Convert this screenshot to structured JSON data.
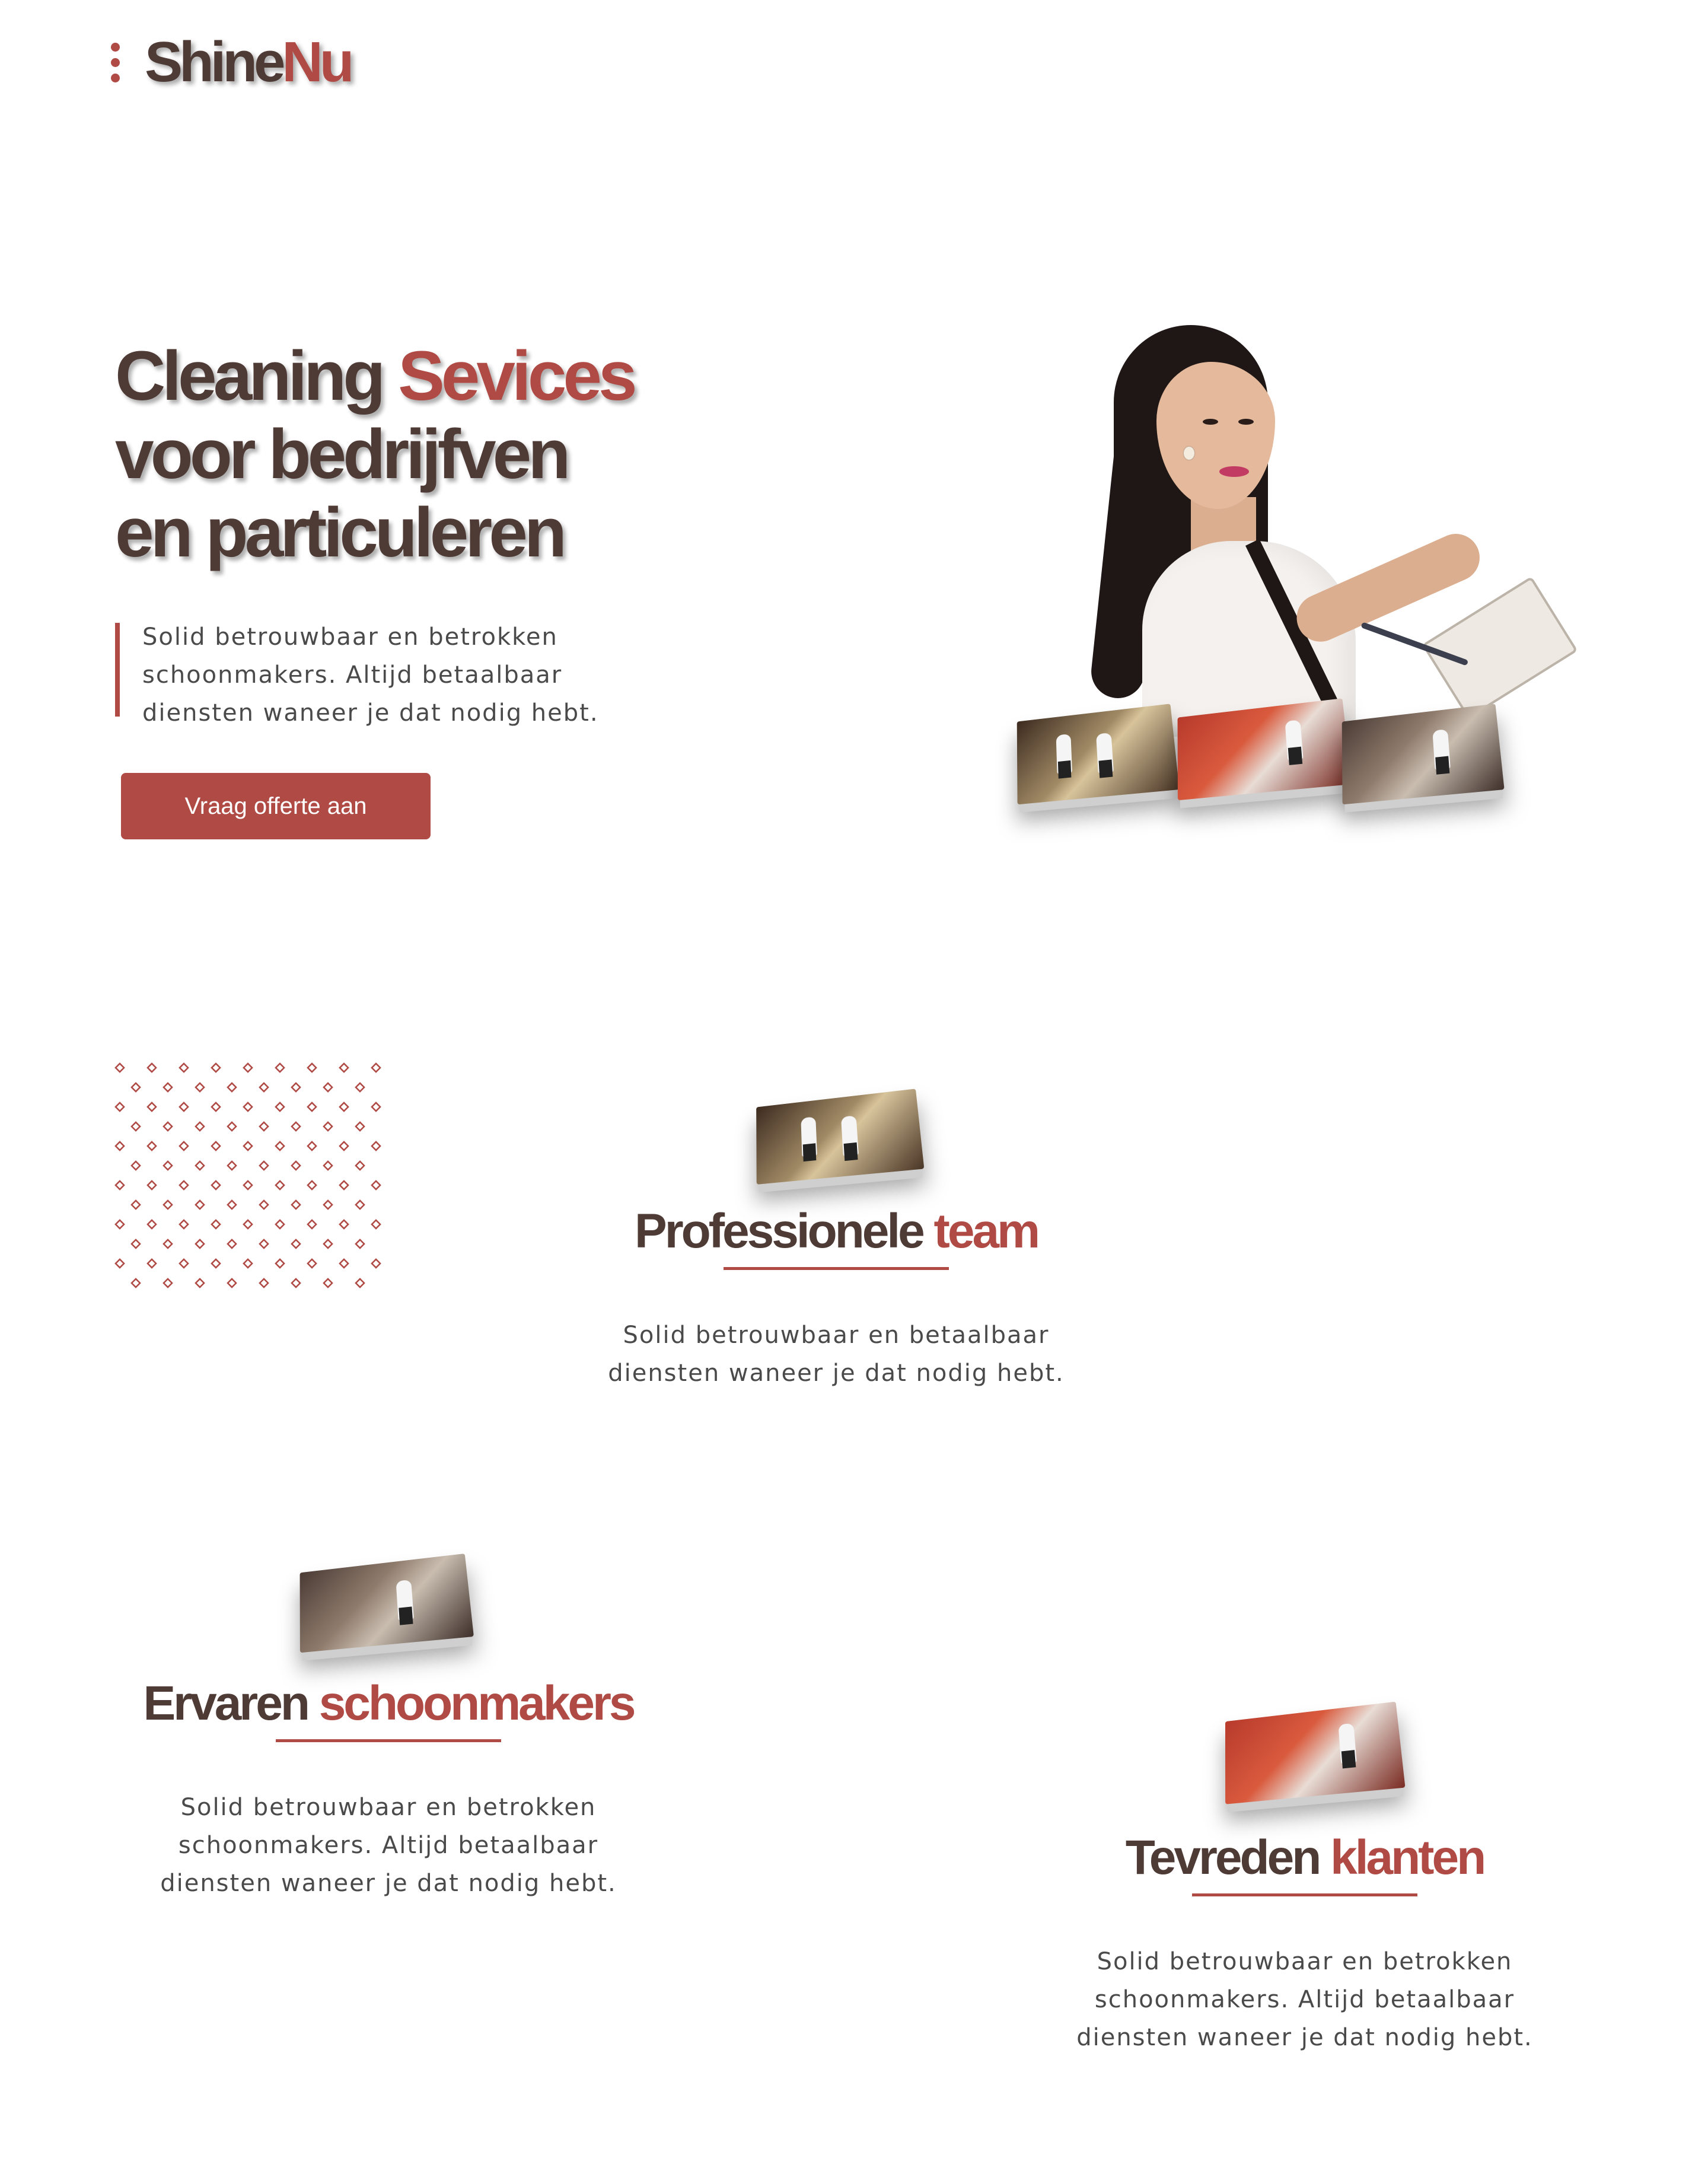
{
  "header": {
    "logo_part1": "Shine",
    "logo_part2": "Nu",
    "menu_icon": "vertical-dots-icon"
  },
  "hero": {
    "title_part1": "Cleaning ",
    "title_part2": "Sevices",
    "title_line2": "voor bedrijfven",
    "title_line3": "en particuleren",
    "intro_lines": [
      "Solid betrouwbaar en betrokken",
      "schoonmakers. Altijd betaalbaar",
      "diensten waneer je dat nodig hebt."
    ],
    "cta_label": "Vraag offerte aan"
  },
  "features": [
    {
      "title_part1": "Professionele ",
      "title_part2": "team",
      "lines": [
        "Solid betrouwbaar en betaalbaar",
        "diensten waneer je dat nodig hebt."
      ]
    },
    {
      "title_part1": "Ervaren ",
      "title_part2": "schoonmakers",
      "lines": [
        "Solid betrouwbaar en betrokken",
        "schoonmakers. Altijd betaalbaar",
        "diensten waneer je dat nodig hebt."
      ]
    },
    {
      "title_part1": "Tevreden ",
      "title_part2": "klanten",
      "lines": [
        "Solid betrouwbaar en betrokken",
        "schoonmakers. Altijd betaalbaar",
        "diensten waneer je dat nodig hebt."
      ]
    }
  ],
  "colors": {
    "brand_red": "#b04a45",
    "brand_dark": "#4e3b36",
    "body_text": "#4a4a4a"
  }
}
